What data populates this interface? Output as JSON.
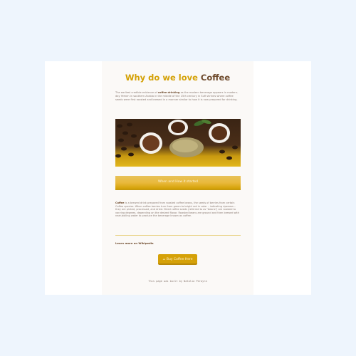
{
  "header": {
    "title_part1": "Why do we love",
    "title_part2": "Coffee"
  },
  "intro": {
    "text_before": "The earliest credible evidence of",
    "highlight": "coffee drinking",
    "text_after": "as the modern beverage appears in modern-day Yemen in southern Arabia in the middle of the 15th century in Sufi shrines where coffee seeds were first roasted and brewed in a manner similar to how it is now prepared for drinking."
  },
  "hero": {
    "image": "coffee-bowls-photo"
  },
  "banner": {
    "label": "When and How it started"
  },
  "article": {
    "lead": "Coffee",
    "text": "is a brewed drink prepared from roasted coffee beans, the seeds of berries from certain Coffea species. When coffee berries turn from green to bright red in color – indicating ripeness – they are picked, processed, and dried. Dried coffee seeds (referred to as \"beans\") are roasted to varying degrees, depending on the desired flavor. Roasted beans are ground and then brewed with near-boiling water to produce the beverage known as coffee."
  },
  "links": {
    "learn_more": "Learn more on Wikipedia"
  },
  "cta": {
    "icon": "coffee-cup-icon",
    "label": "Buy Coffee Here"
  },
  "footer": {
    "text": "This page was built by Natalia Perayra"
  },
  "colors": {
    "accent": "#d4a106",
    "brown": "#6e4a2c",
    "background": "#eef5fd"
  }
}
